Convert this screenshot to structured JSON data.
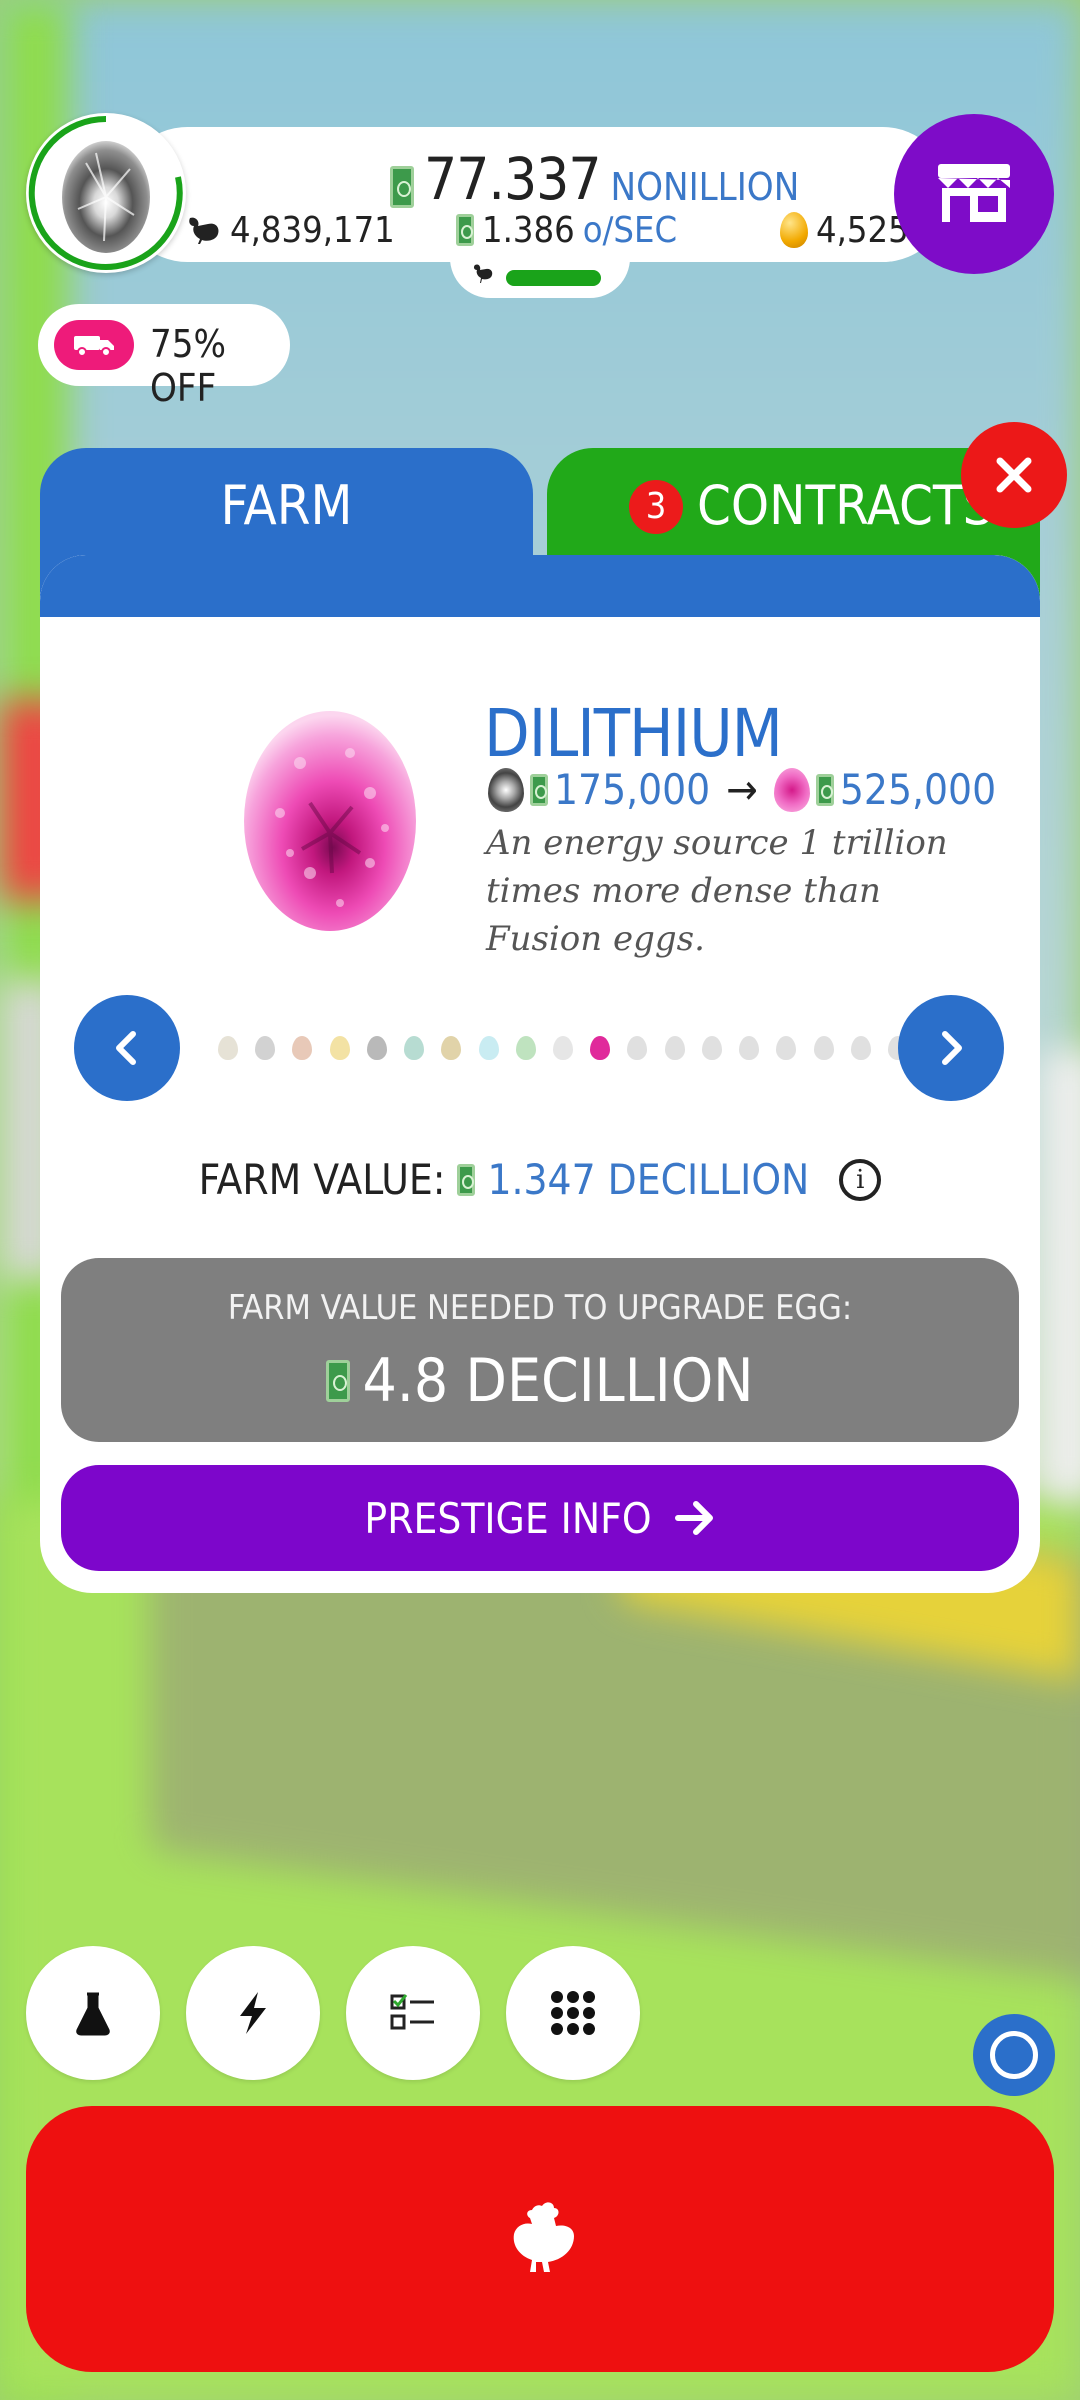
{
  "hud": {
    "current_egg_icon": "fusion-egg-icon",
    "money_value": "77.337",
    "money_unit": "NONILLION",
    "chickens": "4,839,171",
    "rate_value": "1.386",
    "rate_unit": "o/SEC",
    "golden_eggs": "4,525",
    "hab_fill_fraction": 0.95,
    "shop_icon": "shop-icon"
  },
  "promo": {
    "text": "75% OFF",
    "icon": "truck-icon"
  },
  "tabs": {
    "farm_label": "FARM",
    "contracts_label": "CONTRACTS",
    "contracts_badge": "3"
  },
  "egg": {
    "name": "DILITHIUM",
    "prev_value": "175,000",
    "next_value": "525,000",
    "description": "An energy source 1 trillion times more dense than Fusion eggs."
  },
  "egg_dots": [
    {
      "color": "#e6e2d6"
    },
    {
      "color": "#d2d2d2"
    },
    {
      "color": "#e8c9b8"
    },
    {
      "color": "#f3e2a4"
    },
    {
      "color": "#b9b9b9"
    },
    {
      "color": "#b7dcd2"
    },
    {
      "color": "#e1d3a9"
    },
    {
      "color": "#c9ecf2"
    },
    {
      "color": "#bfe3bf"
    },
    {
      "color": "#e6e6e6"
    },
    {
      "color": "#e02a9b"
    },
    {
      "color": "#e0e0e0"
    },
    {
      "color": "#e0e0e0"
    },
    {
      "color": "#e0e0e0"
    },
    {
      "color": "#e0e0e0"
    },
    {
      "color": "#e0e0e0"
    },
    {
      "color": "#e0e0e0"
    },
    {
      "color": "#e0e0e0"
    },
    {
      "color": "#e0e0e0"
    }
  ],
  "farm_value": {
    "label": "FARM VALUE:",
    "value": "1.347 DECILLION"
  },
  "upgrade": {
    "label": "FARM VALUE NEEDED TO UPGRADE EGG:",
    "value": "4.8 DECILLION"
  },
  "prestige_label": "PRESTIGE INFO",
  "bottom_buttons": [
    "research-icon",
    "boost-icon",
    "missions-icon",
    "menu-grid-icon"
  ],
  "colors": {
    "blue": "#2b6fca",
    "green": "#21a919",
    "purple": "#7d06cb",
    "red": "#ec1818",
    "pink_egg": "#e02a9b"
  }
}
